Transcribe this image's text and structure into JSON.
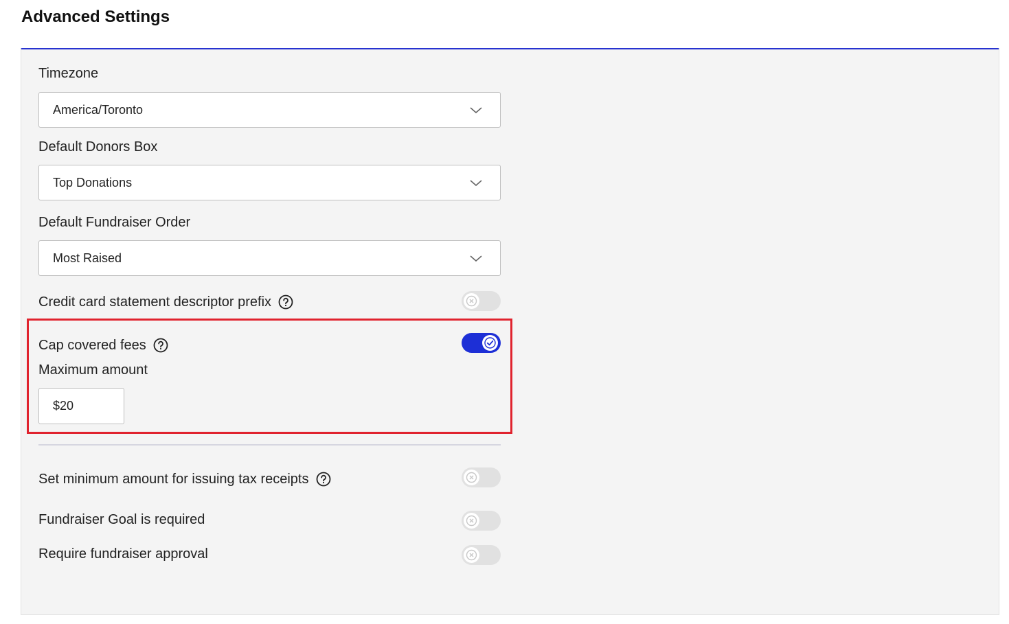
{
  "page": {
    "title": "Advanced Settings"
  },
  "timezone": {
    "label": "Timezone",
    "value": "America/Toronto"
  },
  "donors_box": {
    "label": "Default Donors Box",
    "value": "Top Donations"
  },
  "fundraiser_order": {
    "label": "Default Fundraiser Order",
    "value": "Most Raised"
  },
  "descriptor_prefix": {
    "label": "Credit card statement descriptor prefix",
    "enabled": false
  },
  "cap_fees": {
    "label": "Cap covered fees",
    "enabled": true,
    "max_label": "Maximum amount",
    "max_value": "$20"
  },
  "min_tax_receipt": {
    "label": "Set minimum amount for issuing tax receipts",
    "enabled": false
  },
  "goal_required": {
    "label": "Fundraiser Goal is required",
    "enabled": false
  },
  "require_approval": {
    "label": "Require fundraiser approval",
    "enabled": false
  },
  "colors": {
    "accent": "#1d2fd6",
    "highlight": "#e0232e",
    "panel_bg": "#f4f4f4",
    "toggle_off": "#e1e1e1"
  }
}
